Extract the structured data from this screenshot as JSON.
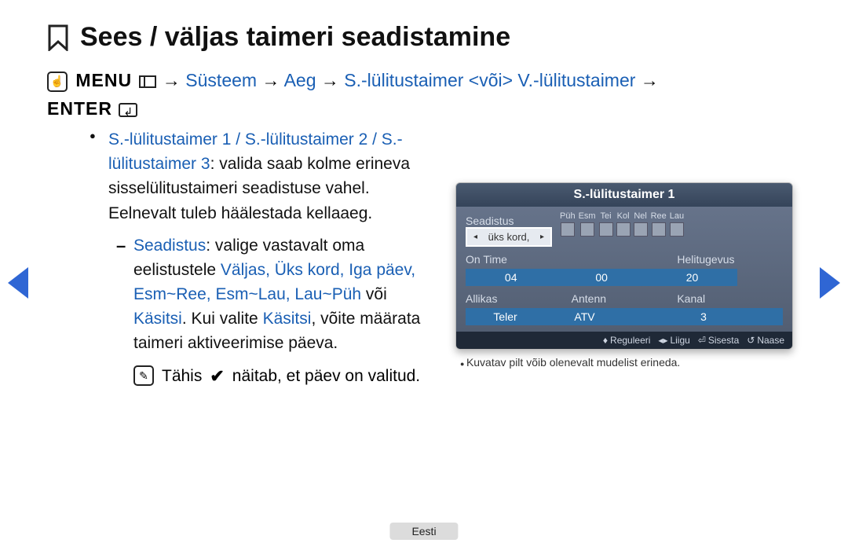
{
  "page": {
    "title": "Sees / väljas taimeri seadistamine",
    "language": "Eesti"
  },
  "nav_path": {
    "menu": "MENU",
    "arrow": "→",
    "steps": [
      "Süsteem",
      "Aeg",
      "S.-lülitustaimer <või> V.-lülitustaimer"
    ],
    "enter": "ENTER"
  },
  "main_bullet": {
    "lead_blue": "S.-lülitustaimer 1 / S.-lülitustaimer 2 / S.-lülitustaimer 3",
    "lead_rest": ": valida saab kolme erineva sisselülitustaimeri seadistuse vahel. Eelnevalt tuleb häälestada kellaaeg."
  },
  "sub_bullet": {
    "label": "Seadistus",
    "text1": ": valige vastavalt oma eelistustele ",
    "options": "Väljas, Üks kord, Iga päev, Esm~Ree, Esm~Lau, Lau~Püh",
    "or": " või ",
    "manual": "Käsitsi",
    "text2": ". Kui valite ",
    "manual2": "Käsitsi",
    "text3": ", võite määrata taimeri aktiveerimise päeva."
  },
  "note": {
    "pre": "Tähis",
    "post": "näitab, et päev on valitud."
  },
  "osd": {
    "title": "S.-lülitustaimer 1",
    "setup_label": "Seadistus",
    "setup_value": "üks kord,",
    "days": [
      "Püh",
      "Esm",
      "Tei",
      "Kol",
      "Nel",
      "Ree",
      "Lau"
    ],
    "ontime_label": "On Time",
    "ontime_hour": "04",
    "ontime_min": "00",
    "volume_label": "Helitugevus",
    "volume_value": "20",
    "source_label": "Allikas",
    "source_value": "Teler",
    "antenna_label": "Antenn",
    "antenna_value": "ATV",
    "channel_label": "Kanal",
    "channel_value": "3",
    "footer": {
      "adjust": "Reguleeri",
      "move": "Liigu",
      "enter": "Sisesta",
      "return": "Naase"
    }
  },
  "caption": "Kuvatav pilt võib olenevalt mudelist erineda."
}
